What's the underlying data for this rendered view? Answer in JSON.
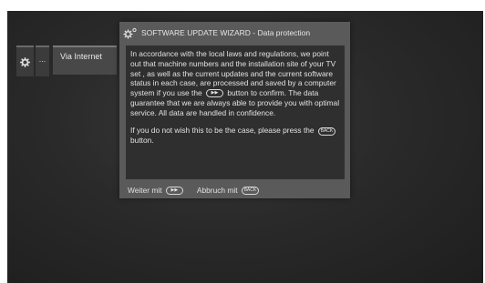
{
  "sidebar": {
    "gear_icon": "gear-icon",
    "more_label": "...",
    "internet_label": "Via Internet"
  },
  "dialog": {
    "title": "SOFTWARE UPDATE WIZARD - Data protection",
    "title_icon": "gears-icon",
    "paragraph1_before": "In accordance with the local laws and regulations, we point out that machine numbers and the installation site of your TV set , as well as the current updates and the current software status in each case, are processed and saved by a computer system if you use the",
    "paragraph1_after": "button to confirm. The data guarantee that we are always able to provide you with optimal service. All data are handled in confidence.",
    "paragraph2_before": "If you do not wish this to be the case, please press the",
    "paragraph2_after": "button.",
    "ok_icon_label": "▶▶",
    "back_icon_label": "BACK",
    "footer_continue": "Weiter mit",
    "footer_cancel": "Abbruch mit"
  }
}
